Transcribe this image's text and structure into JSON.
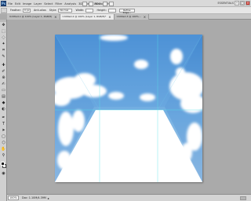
{
  "app": {
    "logo": "Ps",
    "menu": [
      "File",
      "Edit",
      "Image",
      "Layer",
      "Select",
      "Filter",
      "Analysis",
      "3D",
      "View",
      "Window",
      "Help"
    ],
    "zoom": "100",
    "workspace": "ESSENTIALS"
  },
  "options": {
    "feather_label": "Feather:",
    "feather_value": "0 px",
    "antialias_label": "Anti-alias",
    "style_label": "Style:",
    "style_value": "Normal",
    "width_label": "Width:",
    "height_label": "Height:",
    "refine_edge": "Refine Edge..."
  },
  "tabs": [
    {
      "label": "Untitled-1 @ 100% (Layer 1, RGB/8)",
      "close": "×"
    },
    {
      "label": "Untitled-2 @ 100% (Layer 1, RGB/8)*",
      "close": "×"
    },
    {
      "label": "Untitled-3 @ 100%...",
      "close": "×"
    }
  ],
  "status": {
    "zoom": "100%",
    "doc": "Doc: 1.10M/4.39M",
    "arrow": "▸"
  },
  "icons": {
    "move": "✥",
    "marquee": "⬚",
    "lasso": "◌",
    "quick_select": "✦",
    "crop": "⌗",
    "eyedropper": "✎",
    "heal": "✚",
    "brush": "✐",
    "stamp": "⊕",
    "history_brush": "✍",
    "eraser": "▭",
    "gradient": "▤",
    "blur": "◆",
    "dodge": "◐",
    "pen": "✒",
    "type": "T",
    "path_select": "➤",
    "shape": "▢",
    "three_d": "⬡",
    "hand": "✋",
    "zoom": "⚲",
    "mode": "◉"
  }
}
